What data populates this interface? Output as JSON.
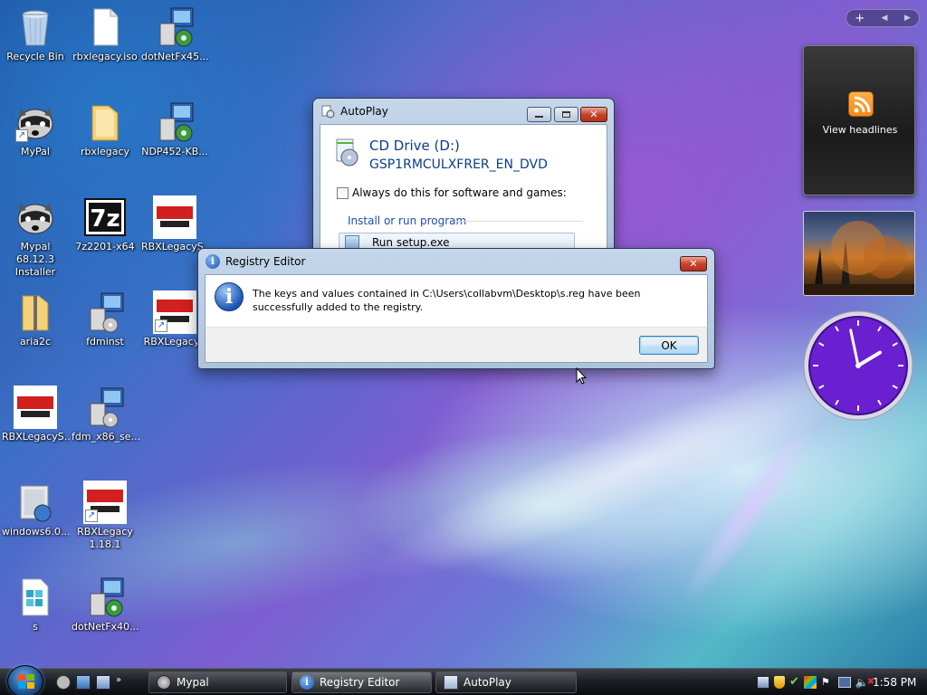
{
  "desktop_icons": [
    {
      "label": "Recycle Bin",
      "icon": "recycle-bin-icon"
    },
    {
      "label": "rbxlegacy.iso",
      "icon": "file-icon"
    },
    {
      "label": "dotNetFx45...",
      "icon": "installer-icon"
    },
    {
      "label": "MyPal",
      "icon": "raccoon-icon"
    },
    {
      "label": "rbxlegacy",
      "icon": "folder-icon"
    },
    {
      "label": "NDP452-KB...",
      "icon": "installer-icon"
    },
    {
      "label": "Mypal 68.12.3 Installer",
      "icon": "raccoon-icon"
    },
    {
      "label": "7z2201-x64",
      "icon": "7zip-icon"
    },
    {
      "label": "RBXLegacyS...",
      "icon": "rbx-legacy-icon"
    },
    {
      "label": "aria2c",
      "icon": "zip-folder-icon"
    },
    {
      "label": "fdminst",
      "icon": "installer-icon"
    },
    {
      "label": "RBXLegacyS",
      "icon": "rbx-legacy-icon"
    },
    {
      "label": "RBXLegacyS...",
      "icon": "rbx-legacy-icon"
    },
    {
      "label": "fdm_x86_se...",
      "icon": "installer-icon"
    },
    {
      "label": "windows6.0...",
      "icon": "update-package-icon"
    },
    {
      "label": "RBXLegacy 1.18.1",
      "icon": "rbx-legacy-icon"
    },
    {
      "label": "s",
      "icon": "registry-file-icon"
    },
    {
      "label": "dotNetFx40...",
      "icon": "installer-icon"
    }
  ],
  "autoplay": {
    "title": "AutoPlay",
    "drive_name": "CD Drive (D:)",
    "volume_label": "GSP1RMCULXFRER_EN_DVD",
    "always_checkbox_label": "Always do this for software and games:",
    "always_checked": false,
    "section_heading": "Install or run program",
    "option_label": "Run setup.exe"
  },
  "registry_dialog": {
    "title": "Registry Editor",
    "message": "The keys and values contained in C:\\Users\\collabvm\\Desktop\\s.reg have been successfully added to the registry.",
    "ok_label": "OK"
  },
  "sidebar": {
    "feed_gadget_label": "View headlines"
  },
  "taskbar": {
    "buttons": [
      {
        "label": "Mypal",
        "icon": "raccoon-icon"
      },
      {
        "label": "Registry Editor",
        "icon": "info-icon"
      },
      {
        "label": "AutoPlay",
        "icon": "autoplay-icon"
      }
    ],
    "clock": "1:58 PM"
  },
  "colors": {
    "accent": "#0b4fa3",
    "clock_face": "#6a1fd0",
    "feed_orange": "#f28a1a"
  },
  "clock_gadget": {
    "hour": 1,
    "minute": 58
  }
}
